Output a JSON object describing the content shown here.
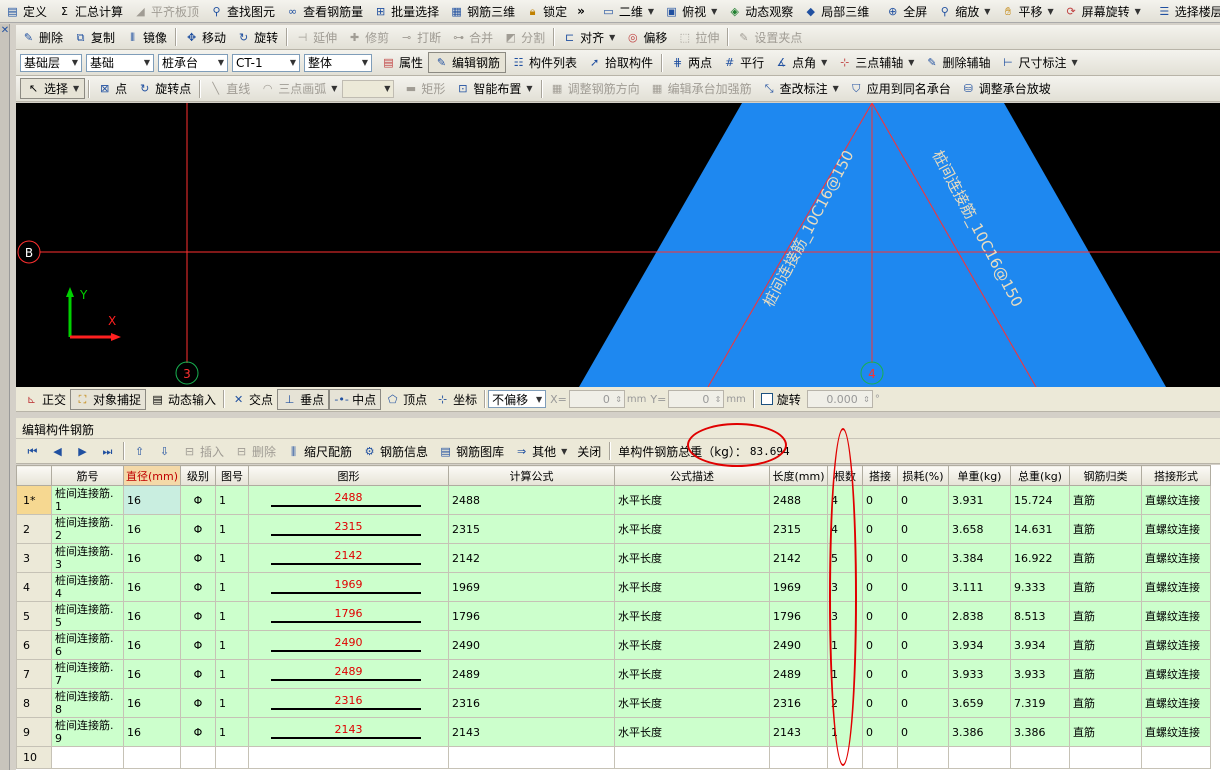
{
  "toolbar1": {
    "items": [
      "定义",
      "汇总计算",
      "平齐板顶",
      "查找图元",
      "查看钢筋量",
      "批量选择",
      "钢筋三维",
      "锁定",
      "二维",
      "俯视",
      "动态观察",
      "局部三维",
      "全屏",
      "缩放",
      "平移",
      "屏幕旋转",
      "选择楼层"
    ]
  },
  "toolbar2": {
    "items": [
      "删除",
      "复制",
      "镜像",
      "移动",
      "旋转",
      "延伸",
      "修剪",
      "打断",
      "合并",
      "分割",
      "对齐",
      "偏移",
      "拉伸",
      "设置夹点"
    ]
  },
  "toolbar3": {
    "combo_floor": "基础层",
    "combo_type": "基础",
    "combo_member": "桩承台",
    "combo_name": "CT-1",
    "combo_mode": "整体",
    "items": [
      "属性",
      "编辑钢筋",
      "构件列表",
      "拾取构件",
      "两点",
      "平行",
      "点角",
      "三点辅轴",
      "删除辅轴",
      "尺寸标注"
    ]
  },
  "toolbar4": {
    "items": [
      "选择",
      "点",
      "旋转点",
      "直线",
      "三点画弧",
      "矩形",
      "智能布置",
      "调整钢筋方向",
      "编辑承台加强筋",
      "查改标注",
      "应用到同名承台",
      "调整承台放坡"
    ]
  },
  "canvas": {
    "axis_b": "B",
    "axis_3": "3",
    "axis_4": "4",
    "coord_y": "Y",
    "coord_x": "X",
    "rebar_label_left": "桩间连接筋_10C16@150",
    "rebar_label_right": "桩间连接筋_10C16@150",
    "colors": {
      "cap": "#1e88f0",
      "axis": "#ff3030",
      "axis_circle": "#18b050"
    }
  },
  "snapbar": {
    "items": [
      "正交",
      "对象捕捉",
      "动态输入",
      "交点",
      "垂点",
      "中点",
      "顶点",
      "坐标"
    ],
    "offset_mode": "不偏移",
    "x_label": "X=",
    "x_value": "0",
    "y_label": "Y=",
    "y_value": "0",
    "unit": "mm",
    "rotate_label": "旋转",
    "rotate_value": "0.000"
  },
  "panel": {
    "title": "编辑构件钢筋",
    "insert": "插入",
    "delete": "删除",
    "scale_rebar": "缩尺配筋",
    "rebar_info": "钢筋信息",
    "rebar_library": "钢筋图库",
    "other": "其他",
    "close": "关闭",
    "total_label": "单构件钢筋总重（kg）：",
    "total_value": "83.694"
  },
  "table": {
    "columns": [
      "筋号",
      "直径(mm)",
      "级别",
      "图号",
      "图形",
      "计算公式",
      "公式描述",
      "长度(mm)",
      "根数",
      "搭接",
      "损耗(%)",
      "单重(kg)",
      "总重(kg)",
      "钢筋归类",
      "搭接形式"
    ],
    "rows": [
      {
        "no": "1*",
        "name": "桩间连接筋.1",
        "dia": "16",
        "grade": "Φ",
        "fig": "1",
        "shape": "2488",
        "formula": "2488",
        "desc": "水平长度",
        "len": "2488",
        "count": "4",
        "lap": "0",
        "loss": "0",
        "unit_w": "3.931",
        "total_w": "15.724",
        "cls": "直筋",
        "lap_type": "直螺纹连接"
      },
      {
        "no": "2",
        "name": "桩间连接筋.2",
        "dia": "16",
        "grade": "Φ",
        "fig": "1",
        "shape": "2315",
        "formula": "2315",
        "desc": "水平长度",
        "len": "2315",
        "count": "4",
        "lap": "0",
        "loss": "0",
        "unit_w": "3.658",
        "total_w": "14.631",
        "cls": "直筋",
        "lap_type": "直螺纹连接"
      },
      {
        "no": "3",
        "name": "桩间连接筋.3",
        "dia": "16",
        "grade": "Φ",
        "fig": "1",
        "shape": "2142",
        "formula": "2142",
        "desc": "水平长度",
        "len": "2142",
        "count": "5",
        "lap": "0",
        "loss": "0",
        "unit_w": "3.384",
        "total_w": "16.922",
        "cls": "直筋",
        "lap_type": "直螺纹连接"
      },
      {
        "no": "4",
        "name": "桩间连接筋.4",
        "dia": "16",
        "grade": "Φ",
        "fig": "1",
        "shape": "1969",
        "formula": "1969",
        "desc": "水平长度",
        "len": "1969",
        "count": "3",
        "lap": "0",
        "loss": "0",
        "unit_w": "3.111",
        "total_w": "9.333",
        "cls": "直筋",
        "lap_type": "直螺纹连接"
      },
      {
        "no": "5",
        "name": "桩间连接筋.5",
        "dia": "16",
        "grade": "Φ",
        "fig": "1",
        "shape": "1796",
        "formula": "1796",
        "desc": "水平长度",
        "len": "1796",
        "count": "3",
        "lap": "0",
        "loss": "0",
        "unit_w": "2.838",
        "total_w": "8.513",
        "cls": "直筋",
        "lap_type": "直螺纹连接"
      },
      {
        "no": "6",
        "name": "桩间连接筋.6",
        "dia": "16",
        "grade": "Φ",
        "fig": "1",
        "shape": "2490",
        "formula": "2490",
        "desc": "水平长度",
        "len": "2490",
        "count": "1",
        "lap": "0",
        "loss": "0",
        "unit_w": "3.934",
        "total_w": "3.934",
        "cls": "直筋",
        "lap_type": "直螺纹连接"
      },
      {
        "no": "7",
        "name": "桩间连接筋.7",
        "dia": "16",
        "grade": "Φ",
        "fig": "1",
        "shape": "2489",
        "formula": "2489",
        "desc": "水平长度",
        "len": "2489",
        "count": "1",
        "lap": "0",
        "loss": "0",
        "unit_w": "3.933",
        "total_w": "3.933",
        "cls": "直筋",
        "lap_type": "直螺纹连接"
      },
      {
        "no": "8",
        "name": "桩间连接筋.8",
        "dia": "16",
        "grade": "Φ",
        "fig": "1",
        "shape": "2316",
        "formula": "2316",
        "desc": "水平长度",
        "len": "2316",
        "count": "2",
        "lap": "0",
        "loss": "0",
        "unit_w": "3.659",
        "total_w": "7.319",
        "cls": "直筋",
        "lap_type": "直螺纹连接"
      },
      {
        "no": "9",
        "name": "桩间连接筋.9",
        "dia": "16",
        "grade": "Φ",
        "fig": "1",
        "shape": "2143",
        "formula": "2143",
        "desc": "水平长度",
        "len": "2143",
        "count": "1",
        "lap": "0",
        "loss": "0",
        "unit_w": "3.386",
        "total_w": "3.386",
        "cls": "直筋",
        "lap_type": "直螺纹连接"
      }
    ],
    "empty_row_no": "10"
  }
}
